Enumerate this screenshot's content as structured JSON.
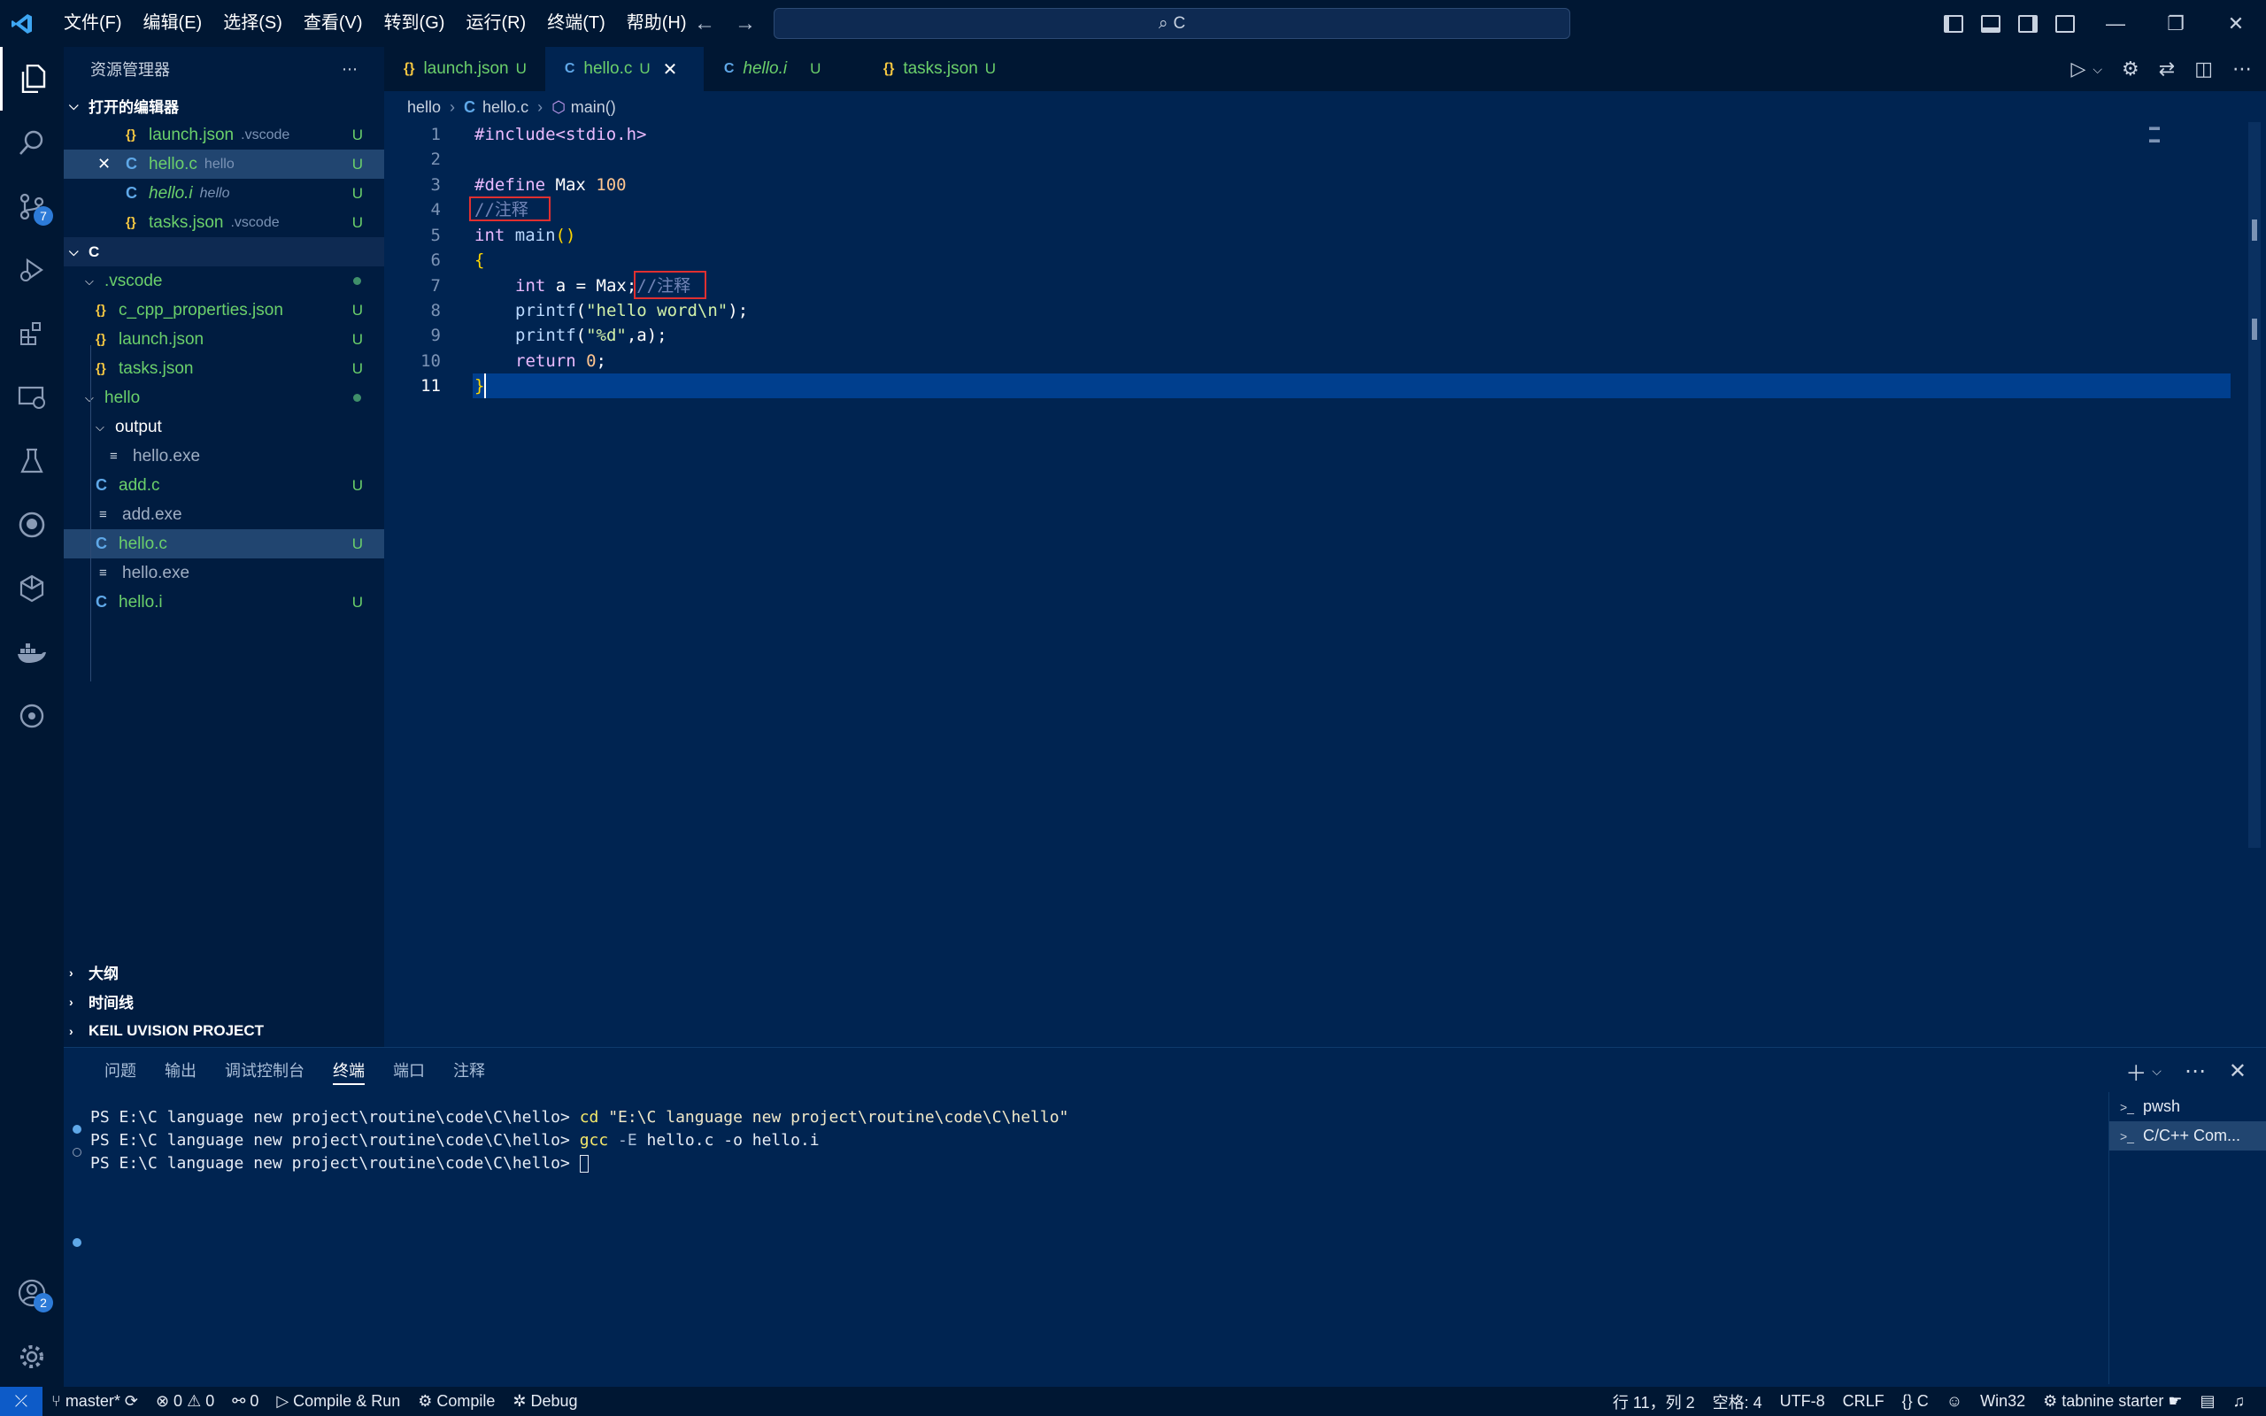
{
  "menu": [
    "文件(F)",
    "编辑(E)",
    "选择(S)",
    "查看(V)",
    "转到(G)",
    "运行(R)",
    "终端(T)",
    "帮助(H)"
  ],
  "command_center": "C",
  "activity_badges": {
    "source_control": "7",
    "accounts": "2"
  },
  "sidebar": {
    "title": "资源管理器",
    "open_editors_label": "打开的编辑器",
    "open_editors": [
      {
        "name": "launch.json",
        "desc": ".vscode",
        "status": "U"
      },
      {
        "name": "hello.c",
        "desc": "hello",
        "status": "U"
      },
      {
        "name": "hello.i",
        "desc": "hello",
        "status": "U"
      },
      {
        "name": "tasks.json",
        "desc": ".vscode",
        "status": "U"
      }
    ],
    "folder_label": "C",
    "tree": [
      {
        "name": ".vscode"
      },
      {
        "name": "c_cpp_properties.json",
        "status": "U"
      },
      {
        "name": "launch.json",
        "status": "U"
      },
      {
        "name": "tasks.json",
        "status": "U"
      },
      {
        "name": "hello"
      },
      {
        "name": "output"
      },
      {
        "name": "hello.exe"
      },
      {
        "name": "add.c",
        "status": "U"
      },
      {
        "name": "add.exe"
      },
      {
        "name": "hello.c",
        "status": "U"
      },
      {
        "name": "hello.exe"
      },
      {
        "name": "hello.i",
        "status": "U"
      }
    ],
    "bottom_sections": [
      "大纲",
      "时间线",
      "KEIL UVISION PROJECT"
    ]
  },
  "tabs": [
    {
      "label": "launch.json",
      "status": "U"
    },
    {
      "label": "hello.c",
      "status": "U"
    },
    {
      "label": "hello.i",
      "status": "U"
    },
    {
      "label": "tasks.json",
      "status": "U"
    }
  ],
  "breadcrumb": [
    "hello",
    "hello.c",
    "main()"
  ],
  "code": {
    "line_numbers": [
      "1",
      "2",
      "3",
      "4",
      "5",
      "6",
      "7",
      "8",
      "9",
      "10",
      "11"
    ],
    "l1": "#include<stdio.h>",
    "l3_kw": "#define",
    "l3_name": " Max ",
    "l3_num": "100",
    "l4": "//注释",
    "l5_kw": "int",
    "l5_fn": " main",
    "l5_paren": "()",
    "l6": "{",
    "l7_kw": "int",
    "l7_rest": " a = Max;",
    "l7_cm": "//注释",
    "l8_fn": "printf",
    "l8_p1": "(",
    "l8_str": "\"hello word\\n\"",
    "l8_p2": ");",
    "l9_fn": "printf",
    "l9_p1": "(",
    "l9_str": "\"%d\"",
    "l9_p2": ",a);",
    "l10_kw": "return",
    "l10_num": "0",
    "l10_end": ";",
    "l11": "}"
  },
  "panel": {
    "tabs": [
      "问题",
      "输出",
      "调试控制台",
      "终端",
      "端口",
      "注释"
    ],
    "terminal": {
      "prompt": "PS E:\\C language new project\\routine\\code\\C\\hello> ",
      "line1_cmd": "cd",
      "line1_arg": " \"E:\\C language new project\\routine\\code\\C\\hello\"",
      "line2_cmd": "gcc",
      "line2_flag": " -E",
      "line2_rest": " hello.c -o hello.i"
    },
    "terminals": [
      "pwsh",
      "C/C++ Com..."
    ]
  },
  "statusbar": {
    "branch": "master*",
    "errors": "0",
    "warnings": "0",
    "ports": "0",
    "compile_run": "Compile & Run",
    "compile": "Compile",
    "debug": "Debug",
    "cursor": "行 11，列 2",
    "spaces": "空格: 4",
    "encoding": "UTF-8",
    "eol": "CRLF",
    "language": "C",
    "platform": "Win32",
    "tabnine": "tabnine starter"
  },
  "colors": {
    "background": "#002451",
    "activity": "#001733",
    "accent": "#0d5bc8",
    "untracked": "#6bd06b",
    "highlight_box": "#e03030"
  }
}
